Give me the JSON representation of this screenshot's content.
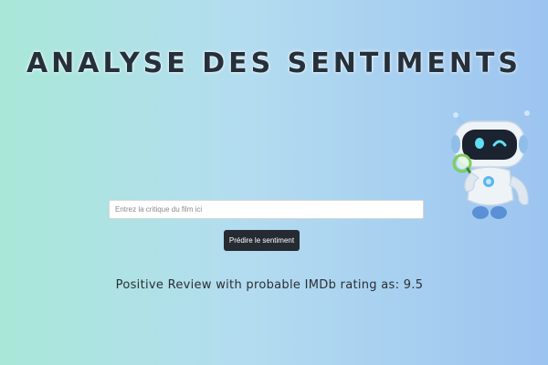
{
  "header": {
    "title": "ANALYSE DES SENTIMENTS"
  },
  "form": {
    "review_placeholder": "Entrez la critique du film ici",
    "review_value": "",
    "predict_label": "Prédire le sentiment"
  },
  "result": {
    "text": "Positive Review with probable IMDb rating as: 9.5"
  },
  "illustration": {
    "icon": "robot-mascot-with-magnifier"
  },
  "colors": {
    "background_left": "#a9e8d8",
    "background_right": "#9cc4f0",
    "button": "#262b33",
    "title": "#26303b"
  }
}
